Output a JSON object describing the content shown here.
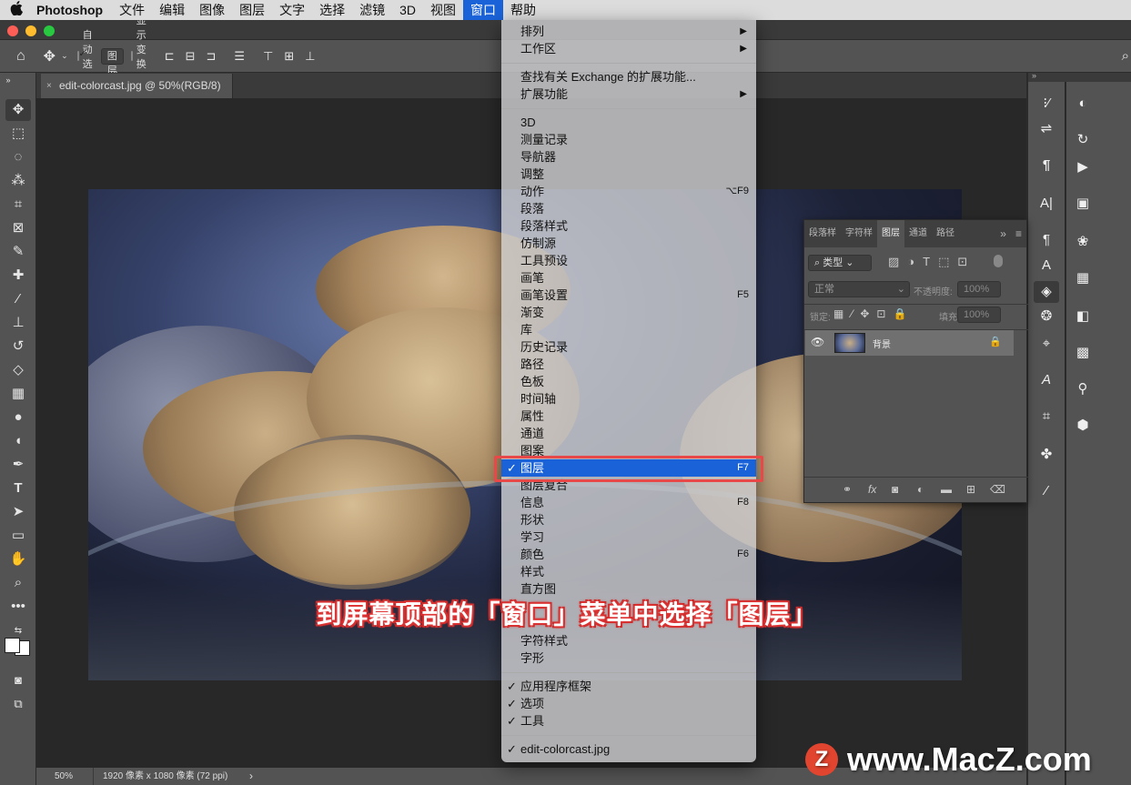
{
  "menubar": {
    "apple": "",
    "app": "Photoshop",
    "items": [
      "文件",
      "编辑",
      "图像",
      "图层",
      "文字",
      "选择",
      "滤镜",
      "3D",
      "视图",
      "窗口",
      "帮助"
    ],
    "active_index": 9
  },
  "options": {
    "auto_select_label": "自动选择:",
    "auto_select_value": "图层",
    "show_transform": "显示变换控件"
  },
  "document": {
    "tab_title": "edit-colorcast.jpg @ 50%(RGB/8)",
    "close": "×"
  },
  "status": {
    "zoom": "50%",
    "info": "1920 像素 x 1080 像素 (72 ppi)",
    "arrow": "›"
  },
  "layers_panel": {
    "tabs": [
      "段落样",
      "字符样",
      "图层",
      "通道",
      "路径"
    ],
    "active_tab": 2,
    "more": "»",
    "filter_kind": "类型",
    "blend_mode": "正常",
    "opacity_label": "不透明度:",
    "opacity_value": "100%",
    "lock_label": "锁定:",
    "fill_label": "填充:",
    "fill_value": "100%",
    "layer_name": "背景"
  },
  "window_menu": {
    "groups": [
      [
        {
          "label": "排列",
          "submenu": true
        },
        {
          "label": "工作区",
          "submenu": true
        }
      ],
      [
        {
          "label": "查找有关 Exchange 的扩展功能..."
        },
        {
          "label": "扩展功能",
          "submenu": true
        }
      ],
      [
        {
          "label": "3D"
        },
        {
          "label": "测量记录"
        },
        {
          "label": "导航器"
        },
        {
          "label": "调整"
        },
        {
          "label": "动作",
          "shortcut": "⌥F9"
        },
        {
          "label": "段落"
        },
        {
          "label": "段落样式"
        },
        {
          "label": "仿制源"
        },
        {
          "label": "工具预设"
        },
        {
          "label": "画笔"
        },
        {
          "label": "画笔设置",
          "shortcut": "F5"
        },
        {
          "label": "渐变"
        },
        {
          "label": "库"
        },
        {
          "label": "历史记录"
        },
        {
          "label": "路径"
        },
        {
          "label": "色板"
        },
        {
          "label": "时间轴"
        },
        {
          "label": "属性"
        },
        {
          "label": "通道"
        },
        {
          "label": "图案"
        },
        {
          "label": "图层",
          "shortcut": "F7",
          "checked": true,
          "highlighted": true
        },
        {
          "label": "图层复合"
        },
        {
          "label": "信息",
          "shortcut": "F8"
        },
        {
          "label": "形状"
        },
        {
          "label": "学习"
        },
        {
          "label": "颜色",
          "shortcut": "F6"
        },
        {
          "label": "样式"
        },
        {
          "label": "直方图"
        },
        {
          "label": ""
        },
        {
          "label": ""
        },
        {
          "label": "字符样式"
        },
        {
          "label": "字形"
        }
      ],
      [
        {
          "label": "应用程序框架",
          "checked": true
        },
        {
          "label": "选项",
          "checked": true
        },
        {
          "label": "工具",
          "checked": true
        }
      ],
      [
        {
          "label": "edit-colorcast.jpg",
          "checked": true
        }
      ]
    ],
    "check": "✓",
    "arrow": "▶"
  },
  "caption": "到屏幕顶部的「窗口」菜单中选择「图层」",
  "watermark": {
    "logo": "Z",
    "text": "www.MacZ.com"
  },
  "colors": {
    "menu_highlight": "#1a62d8",
    "callout_red": "#e84848",
    "panel": "#535353"
  }
}
